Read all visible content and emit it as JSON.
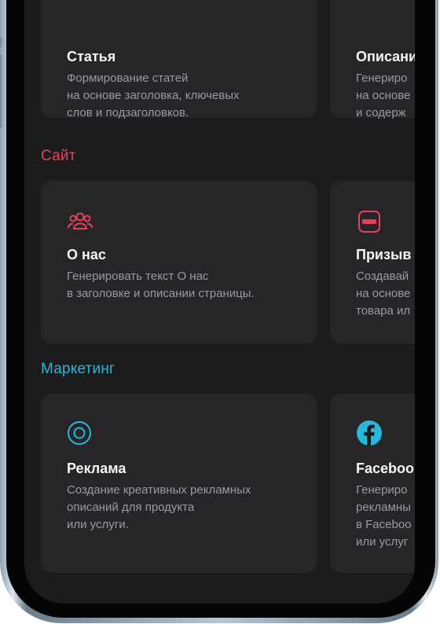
{
  "sections": [
    {
      "title": "",
      "cards": [
        {
          "title": "Статья",
          "lines": [
            "Формирование статей",
            "на основе заголовка, ключевых",
            "слов и подзаголовков."
          ]
        },
        {
          "title": "Описани",
          "lines": [
            "Генериро",
            "на основе",
            "и содерж"
          ]
        }
      ]
    },
    {
      "title": "Сайт",
      "color": "#e8405a",
      "cards": [
        {
          "title": "О нас",
          "icon": "users-icon",
          "lines": [
            "Генерировать текст О нас",
            "в заголовке и описании страницы."
          ]
        },
        {
          "title": "Призыв",
          "icon": "minus-box-icon",
          "lines": [
            "Создавай",
            "на основе",
            "товара ил"
          ]
        }
      ]
    },
    {
      "title": "Маркетинг",
      "color": "#2ab7d8",
      "cards": [
        {
          "title": "Реклама",
          "icon": "target-icon",
          "lines": [
            "Создание креативных рекламных",
            "описаний для продукта",
            "или услуги."
          ]
        },
        {
          "title": "Faceboo",
          "icon": "facebook-icon",
          "lines": [
            "Генериро",
            "рекламны",
            "в Faceboo",
            "или услуг"
          ]
        }
      ]
    }
  ],
  "colors": {
    "screen_bg": "#1c1c1e",
    "card_bg": "#262629",
    "accent_red": "#e8405a",
    "accent_cyan": "#2ab7d8"
  }
}
